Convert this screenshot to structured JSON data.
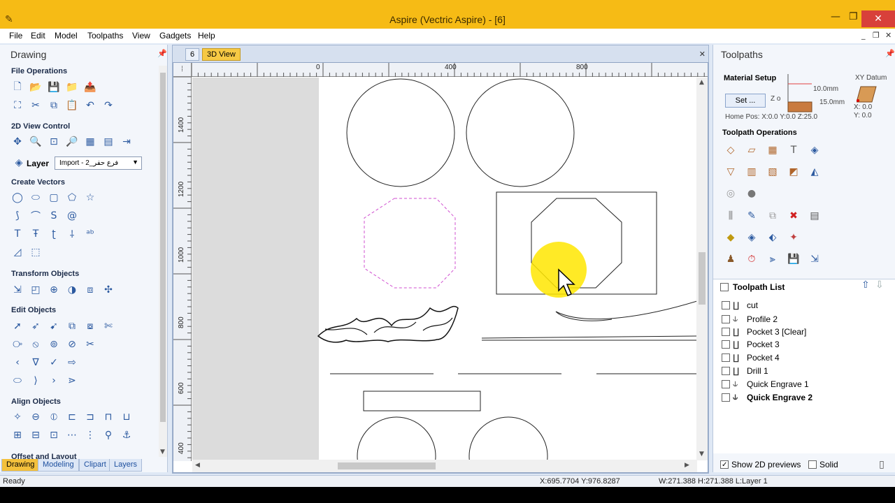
{
  "window": {
    "title": "Aspire (Vectric Aspire) - [6]"
  },
  "menu": [
    "File",
    "Edit",
    "Model",
    "Toolpaths",
    "View",
    "Gadgets",
    "Help"
  ],
  "left_panel": {
    "title": "Drawing",
    "sections": {
      "file_operations": "File Operations",
      "view_control": "2D View Control",
      "create_vectors": "Create Vectors",
      "transform": "Transform Objects",
      "edit": "Edit Objects",
      "align": "Align Objects",
      "offset": "Offset and Layout"
    },
    "layer_label": "Layer",
    "layer_value": "Import - 2_فرع حفر",
    "tabs": [
      "Drawing",
      "Modeling",
      "Clipart",
      "Layers"
    ]
  },
  "center": {
    "doc_tab": "6",
    "view_tab": "3D View",
    "ruler_h": [
      "0",
      "400",
      "800"
    ],
    "ruler_v": [
      "1400",
      "1200",
      "1000",
      "800",
      "600",
      "400"
    ]
  },
  "right_panel": {
    "title": "Toolpaths",
    "material_setup": "Material Setup",
    "set_button": "Set ...",
    "z_label": "Z o",
    "depth1": "10.0mm",
    "depth2": "15.0mm",
    "home_pos": "Home Pos:  X:0.0 Y:0.0 Z:25.0",
    "xy_datum": "XY Datum",
    "datum_x": "X: 0.0",
    "datum_y": "Y: 0.0",
    "operations_title": "Toolpath Operations",
    "list_title": "Toolpath List",
    "toolpaths": [
      "cut",
      "Profile 2",
      "Pocket 3 [Clear]",
      "Pocket 3",
      "Pocket 4",
      "Drill 1",
      "Quick Engrave 1",
      "Quick Engrave 2"
    ],
    "show_2d": "Show 2D previews",
    "solid": "Solid"
  },
  "status": {
    "ready": "Ready",
    "coords": "X:695.7704 Y:976.8287",
    "size": "W:271.388  H:271.388  L:Layer 1"
  },
  "colors": {
    "title_bar": "#f6bb15",
    "accent": "#2c5aa0",
    "highlight": "#ffe600",
    "selection_dash": "#d04fd0"
  }
}
